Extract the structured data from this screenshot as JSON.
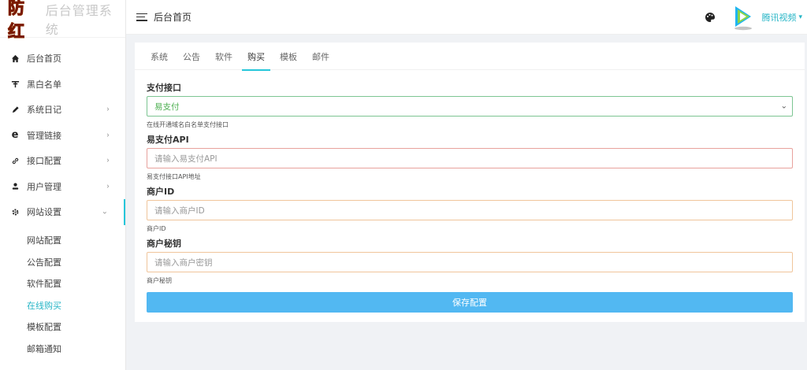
{
  "brand": {
    "logo": "防红",
    "title": "后台管理系统"
  },
  "header": {
    "title": "后台首页",
    "user_name": "腾讯视频"
  },
  "sidebar": {
    "items": [
      {
        "label": "后台首页",
        "icon": "home-icon",
        "has_arrow": false
      },
      {
        "label": "黑白名单",
        "icon": "list-icon",
        "has_arrow": false
      },
      {
        "label": "系统日记",
        "icon": "pen-icon",
        "has_arrow": true
      },
      {
        "label": "管理链接",
        "icon": "browser-e-icon",
        "has_arrow": true
      },
      {
        "label": "接口配置",
        "icon": "link-icon",
        "has_arrow": true
      },
      {
        "label": "用户管理",
        "icon": "user-icon",
        "has_arrow": true
      },
      {
        "label": "网站设置",
        "icon": "gear-icon",
        "has_arrow": true,
        "expanded": true
      }
    ],
    "sub_items": [
      {
        "label": "网站配置"
      },
      {
        "label": "公告配置"
      },
      {
        "label": "软件配置"
      },
      {
        "label": "在线购买",
        "active": true
      },
      {
        "label": "模板配置"
      },
      {
        "label": "邮箱通知"
      }
    ]
  },
  "tabs": [
    {
      "label": "系统"
    },
    {
      "label": "公告"
    },
    {
      "label": "软件"
    },
    {
      "label": "购买",
      "active": true
    },
    {
      "label": "模板"
    },
    {
      "label": "邮件"
    }
  ],
  "form": {
    "payment": {
      "label": "支付接口",
      "value": "易支付",
      "help": "在线开通域名白名单支付接口"
    },
    "api": {
      "label": "易支付API",
      "placeholder": "请输入易支付API",
      "help": "易支付接口API地址"
    },
    "merchant_id": {
      "label": "商户ID",
      "placeholder": "请输入商户ID",
      "help": "商户ID"
    },
    "merchant_key": {
      "label": "商户秘钥",
      "placeholder": "请输入商户密钥",
      "help": "商户秘钥"
    },
    "save_label": "保存配置"
  },
  "colors": {
    "accent": "#26c6da",
    "button": "#52b8f2",
    "select_border": "#7cc592",
    "error_border": "#e8a29d",
    "warn_border": "#f0c59b"
  }
}
